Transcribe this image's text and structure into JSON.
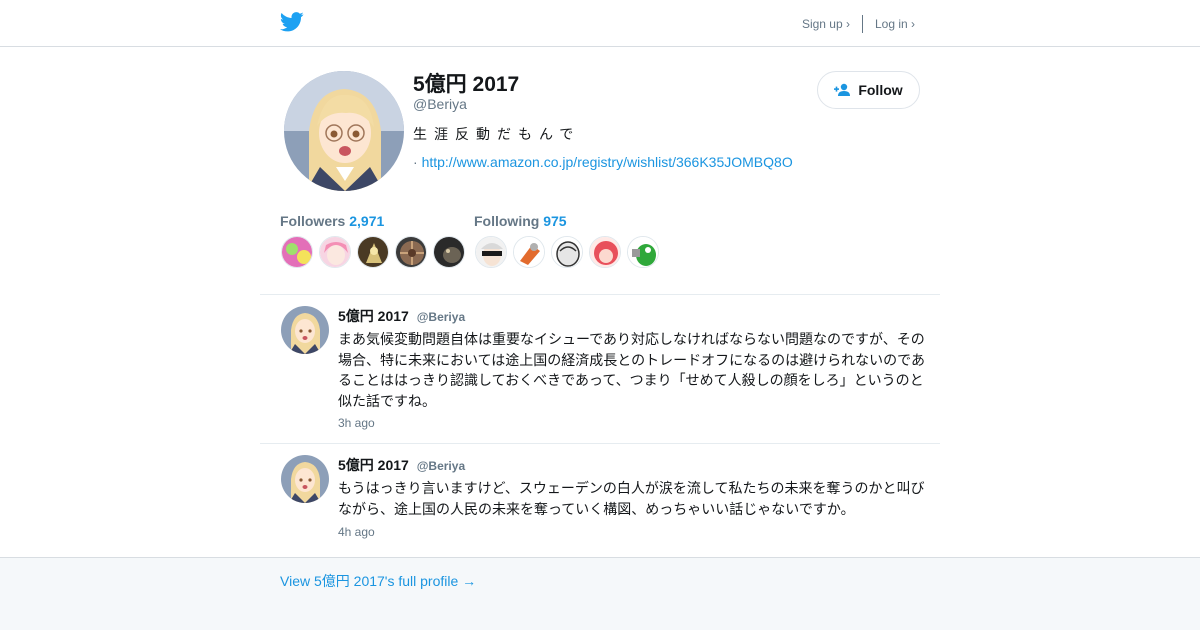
{
  "header": {
    "logo_icon": "twitter-bird-icon",
    "signup_label": "Sign up ›",
    "login_label": "Log in ›"
  },
  "profile": {
    "name": "5億円 2017",
    "handle": "@Beriya",
    "bio": "生涯反動だもんで",
    "url_prefix": "·",
    "url": "http://www.amazon.co.jp/registry/wishlist/366K35JOMBQ8O",
    "follow_label": "Follow",
    "follow_icon": "add-user-icon"
  },
  "stats": {
    "followers_label": "Followers",
    "followers_count": "2,971",
    "following_label": "Following",
    "following_count": "975"
  },
  "tweets": [
    {
      "name": "5億円 2017",
      "handle": "@Beriya",
      "text": "まあ気候変動問題自体は重要なイシューであり対応しなければならない問題なのですが、その場合、特に未来においては途上国の経済成長とのトレードオフになるのは避けられないのであることははっきり認識しておくべきであって、つまり「せめて人殺しの顔をしろ」というのと似た話ですね。",
      "time": "3h ago"
    },
    {
      "name": "5億円 2017",
      "handle": "@Beriya",
      "text": "もうはっきり言いますけど、スウェーデンの白人が涙を流して私たちの未来を奪うのかと叫びながら、途上国の人民の未来を奪っていく構図、めっちゃいい話じゃないですか。",
      "time": "4h ago"
    }
  ],
  "footer": {
    "full_profile_label": "View 5億円 2017's full profile →"
  },
  "colors": {
    "accent": "#1b95e0",
    "muted": "#657786",
    "text": "#14171a",
    "border": "#e6ecf0",
    "footer_bg": "#f5f8fa"
  }
}
